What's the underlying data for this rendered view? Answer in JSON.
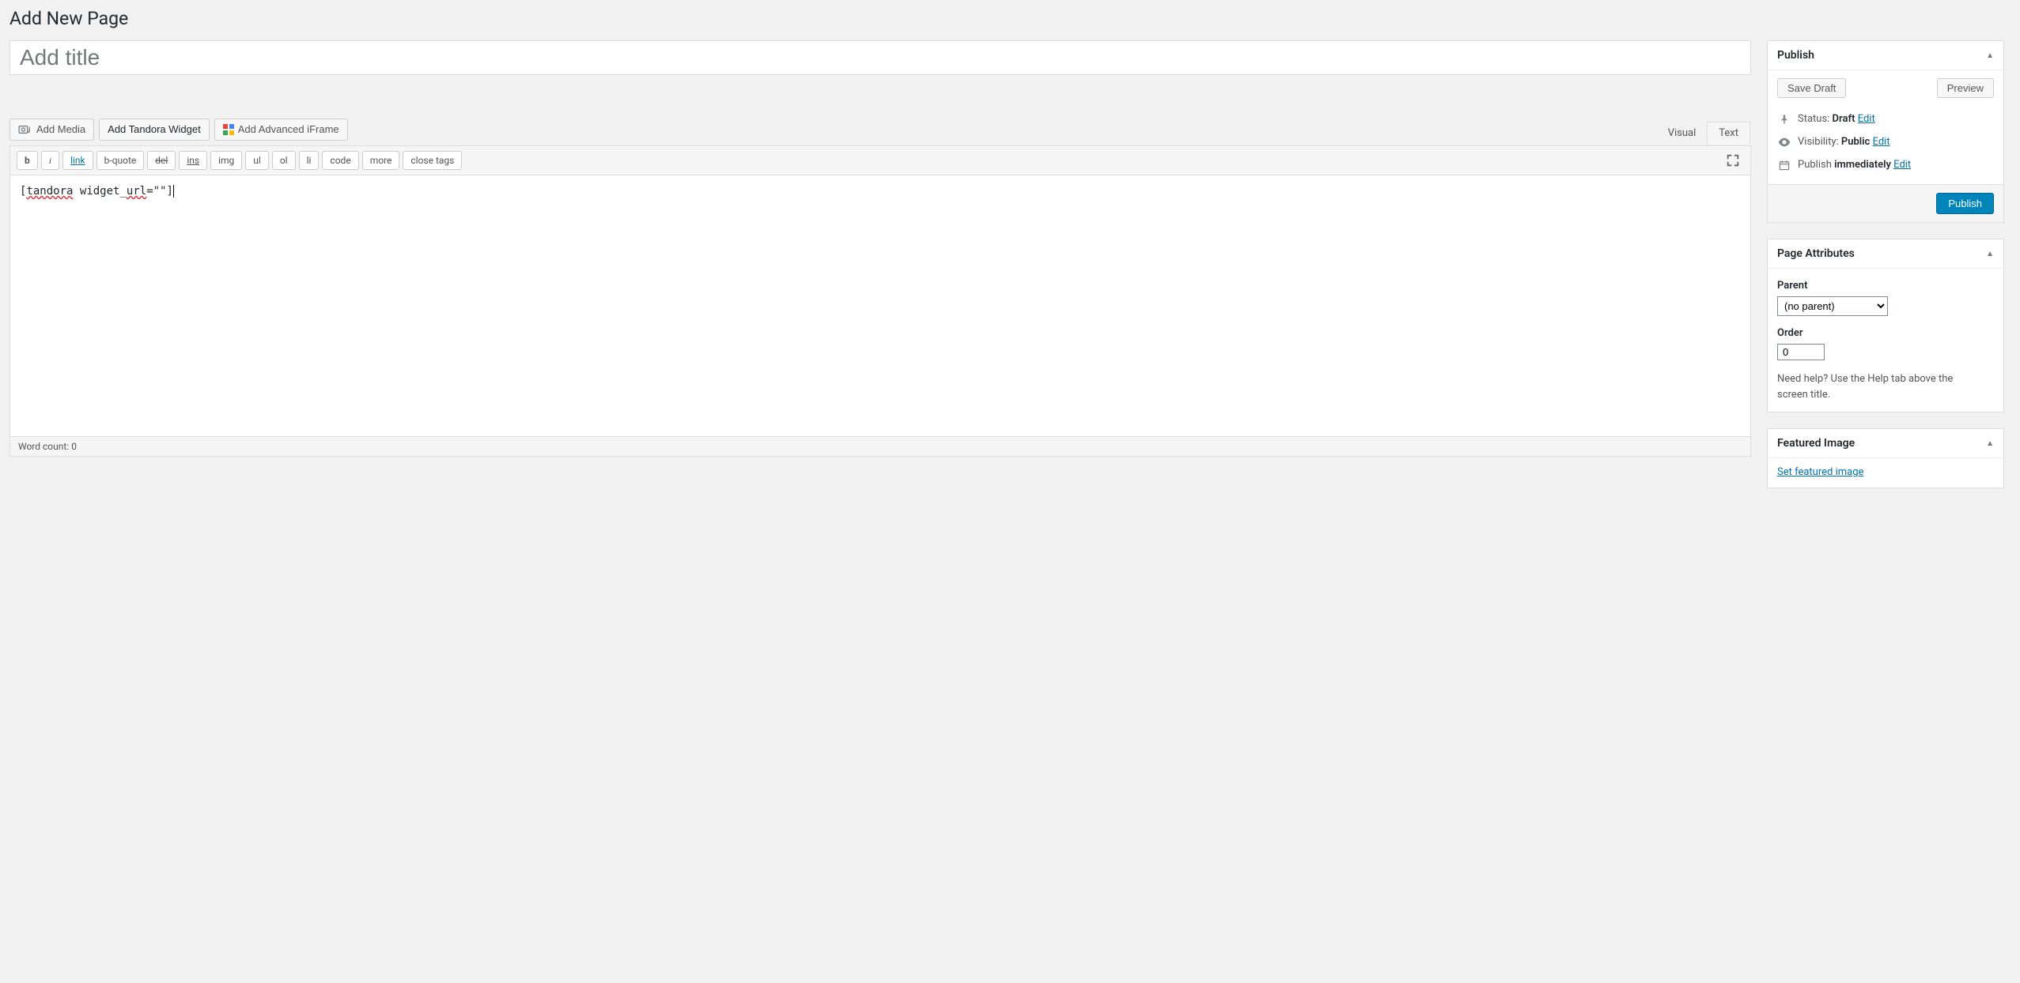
{
  "page": {
    "title": "Add New Page"
  },
  "title_input": {
    "placeholder": "Add title",
    "value": ""
  },
  "media_buttons": {
    "add_media": "Add Media",
    "add_tandora": "Add Tandora Widget",
    "add_iframe": "Add Advanced iFrame"
  },
  "editor_tabs": {
    "visual": "Visual",
    "text": "Text",
    "active": "text"
  },
  "quicktags": [
    "b",
    "i",
    "link",
    "b-quote",
    "del",
    "ins",
    "img",
    "ul",
    "ol",
    "li",
    "code",
    "more",
    "close tags"
  ],
  "editor_content_parts": {
    "open": "[",
    "word1": "tandora",
    "space1": " ",
    "wordp": "widget_",
    "word2": "url",
    "rest": "=\"\"]"
  },
  "word_count": {
    "label": "Word count: ",
    "value": "0"
  },
  "publish": {
    "panel_title": "Publish",
    "save_draft": "Save Draft",
    "preview": "Preview",
    "status_label": "Status: ",
    "status_value": "Draft",
    "visibility_label": "Visibility: ",
    "visibility_value": "Public",
    "publish_label": "Publish ",
    "publish_value": "immediately",
    "edit": "Edit",
    "publish_button": "Publish"
  },
  "page_attributes": {
    "panel_title": "Page Attributes",
    "parent_label": "Parent",
    "parent_selected": "(no parent)",
    "order_label": "Order",
    "order_value": "0",
    "help_text": "Need help? Use the Help tab above the screen title."
  },
  "featured_image": {
    "panel_title": "Featured Image",
    "set_link": "Set featured image"
  }
}
